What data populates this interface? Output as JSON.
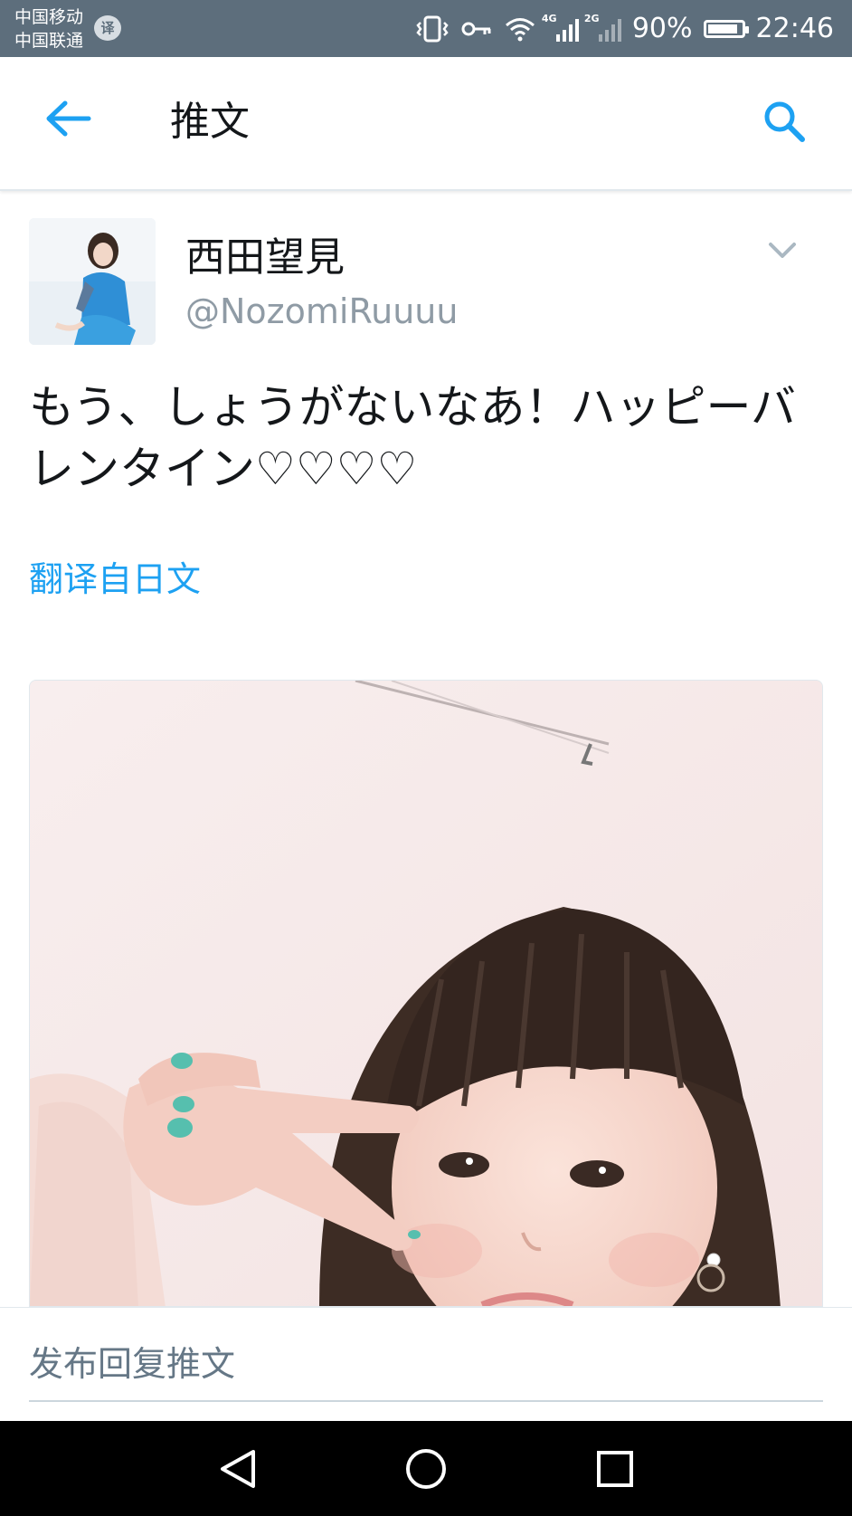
{
  "status_bar": {
    "carrier_1": "中国移动",
    "carrier_2": "中国联通",
    "carrier_badge": "译",
    "network_4g": "4G",
    "network_2g": "2G",
    "battery_percent": "90%",
    "battery_level": 0.9,
    "time": "22:46",
    "icons": [
      "vibrate-icon",
      "key-icon",
      "wifi-icon",
      "signal-4g-icon",
      "signal-2g-icon",
      "battery-icon"
    ]
  },
  "header": {
    "title": "推文",
    "back_icon": "arrow-left-icon",
    "search_icon": "search-icon"
  },
  "tweet": {
    "display_name": "西田望見",
    "handle": "@NozomiRuuuu",
    "text": "もう、しょうがないなあ！ハッピーバレンタイン♡♡♡♡",
    "translate_link": "翻译自日文",
    "menu_icon": "chevron-down-icon"
  },
  "reply": {
    "placeholder": "发布回复推文"
  },
  "navbar": {
    "icons": [
      "back-triangle-icon",
      "home-circle-icon",
      "recents-square-icon"
    ]
  },
  "colors": {
    "status_bar": "#5d6e7c",
    "accent": "#1da1f2",
    "text": "#14171a",
    "secondary_text": "#8f9ba5",
    "navbar": "#000000"
  }
}
